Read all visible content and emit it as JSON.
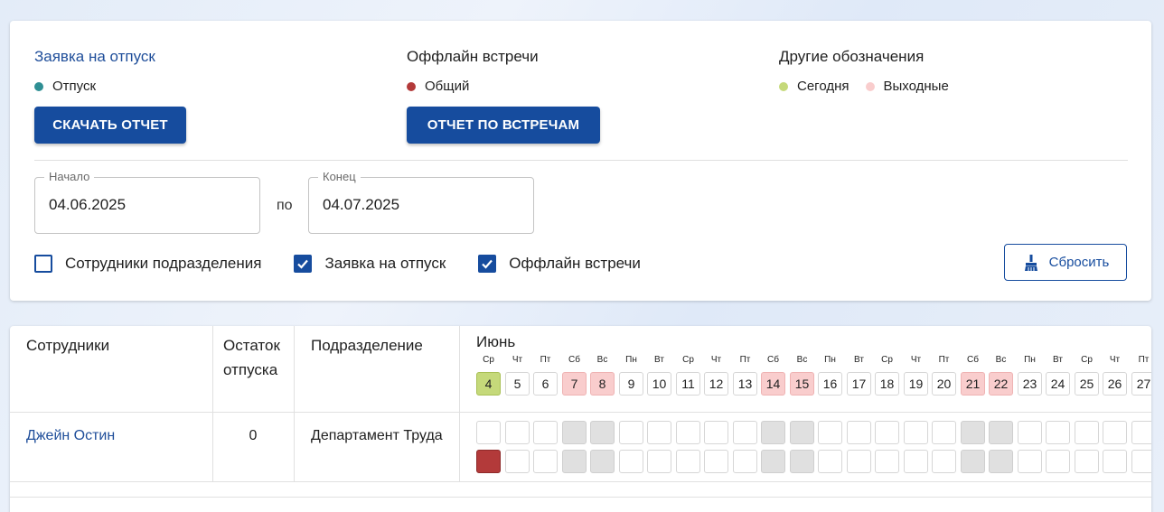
{
  "legend": {
    "vacation": {
      "title": "Заявка на отпуск",
      "item": "Отпуск",
      "color": "#2f8f94",
      "button": "СКАЧАТЬ ОТЧЕТ"
    },
    "meetings": {
      "title": "Оффлайн встречи",
      "item": "Общий",
      "color": "#b33a3a",
      "button": "ОТЧЕТ ПО ВСТРЕЧАМ"
    },
    "other": {
      "title": "Другие обозначения",
      "today": "Сегодня",
      "today_color": "#c5d97a",
      "weekend": "Выходные",
      "weekend_color": "#f9cdcd"
    }
  },
  "range": {
    "start_label": "Начало",
    "start_value": "04.06.2025",
    "separator": "по",
    "end_label": "Конец",
    "end_value": "04.07.2025"
  },
  "filters": [
    {
      "label": "Сотрудники подразделения",
      "checked": false
    },
    {
      "label": "Заявка на отпуск",
      "checked": true
    },
    {
      "label": "Оффлайн встречи",
      "checked": true
    }
  ],
  "reset_label": "Сбросить",
  "table": {
    "headers": {
      "employees": "Сотрудники",
      "rest_line1": "Остаток",
      "rest_line2": "отпуска",
      "department": "Подразделение"
    },
    "month": "Июнь",
    "days": [
      {
        "dow": "Ср",
        "num": "4",
        "type": "today"
      },
      {
        "dow": "Чт",
        "num": "5",
        "type": ""
      },
      {
        "dow": "Пт",
        "num": "6",
        "type": ""
      },
      {
        "dow": "Сб",
        "num": "7",
        "type": "weekend"
      },
      {
        "dow": "Вс",
        "num": "8",
        "type": "weekend"
      },
      {
        "dow": "Пн",
        "num": "9",
        "type": ""
      },
      {
        "dow": "Вт",
        "num": "10",
        "type": ""
      },
      {
        "dow": "Ср",
        "num": "11",
        "type": ""
      },
      {
        "dow": "Чт",
        "num": "12",
        "type": ""
      },
      {
        "dow": "Пт",
        "num": "13",
        "type": ""
      },
      {
        "dow": "Сб",
        "num": "14",
        "type": "weekend"
      },
      {
        "dow": "Вс",
        "num": "15",
        "type": "weekend"
      },
      {
        "dow": "Пн",
        "num": "16",
        "type": ""
      },
      {
        "dow": "Вт",
        "num": "17",
        "type": ""
      },
      {
        "dow": "Ср",
        "num": "18",
        "type": ""
      },
      {
        "dow": "Чт",
        "num": "19",
        "type": ""
      },
      {
        "dow": "Пт",
        "num": "20",
        "type": ""
      },
      {
        "dow": "Сб",
        "num": "21",
        "type": "weekend"
      },
      {
        "dow": "Вс",
        "num": "22",
        "type": "weekend"
      },
      {
        "dow": "Пн",
        "num": "23",
        "type": ""
      },
      {
        "dow": "Вт",
        "num": "24",
        "type": ""
      },
      {
        "dow": "Ср",
        "num": "25",
        "type": ""
      },
      {
        "dow": "Чт",
        "num": "26",
        "type": ""
      },
      {
        "dow": "Пт",
        "num": "27",
        "type": ""
      }
    ],
    "rows": [
      {
        "name": "Джейн Остин",
        "rest": "0",
        "department": "Департамент Труда",
        "meeting_days": [
          "4"
        ]
      }
    ]
  }
}
